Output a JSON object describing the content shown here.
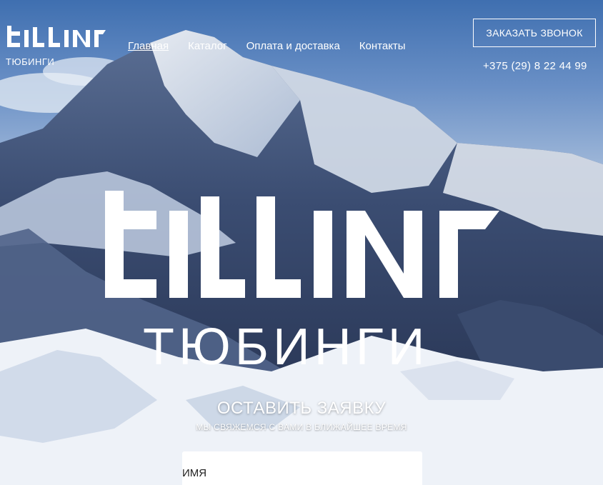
{
  "brand": {
    "logo_text": "TILLINI",
    "tagline": "ТЮБИНГИ"
  },
  "nav": {
    "items": [
      {
        "label": "Главная",
        "active": true
      },
      {
        "label": "Каталог",
        "active": false
      },
      {
        "label": "Оплата и доставка",
        "active": false
      },
      {
        "label": "Контакты",
        "active": false
      }
    ]
  },
  "header": {
    "call_button_label": "ЗАКАЗАТЬ ЗВОНОК",
    "phone": "+375 (29) 8 22 44 99"
  },
  "hero": {
    "logo_text": "TILLINI",
    "subtitle": "ТЮБИНГИ",
    "background_icon": "snowy-mountain-photo"
  },
  "request_form": {
    "title": "ОСТАВИТЬ ЗАЯВКУ",
    "subtitle": "МЫ СВЯЖЕМСЯ С ВАМИ В БЛИЖАЙШЕЕ ВРЕМЯ",
    "name_placeholder": "ИМЯ"
  },
  "colors": {
    "text": "#ffffff",
    "sky": "#3f6fb0",
    "snow": "#f2f5f9"
  }
}
